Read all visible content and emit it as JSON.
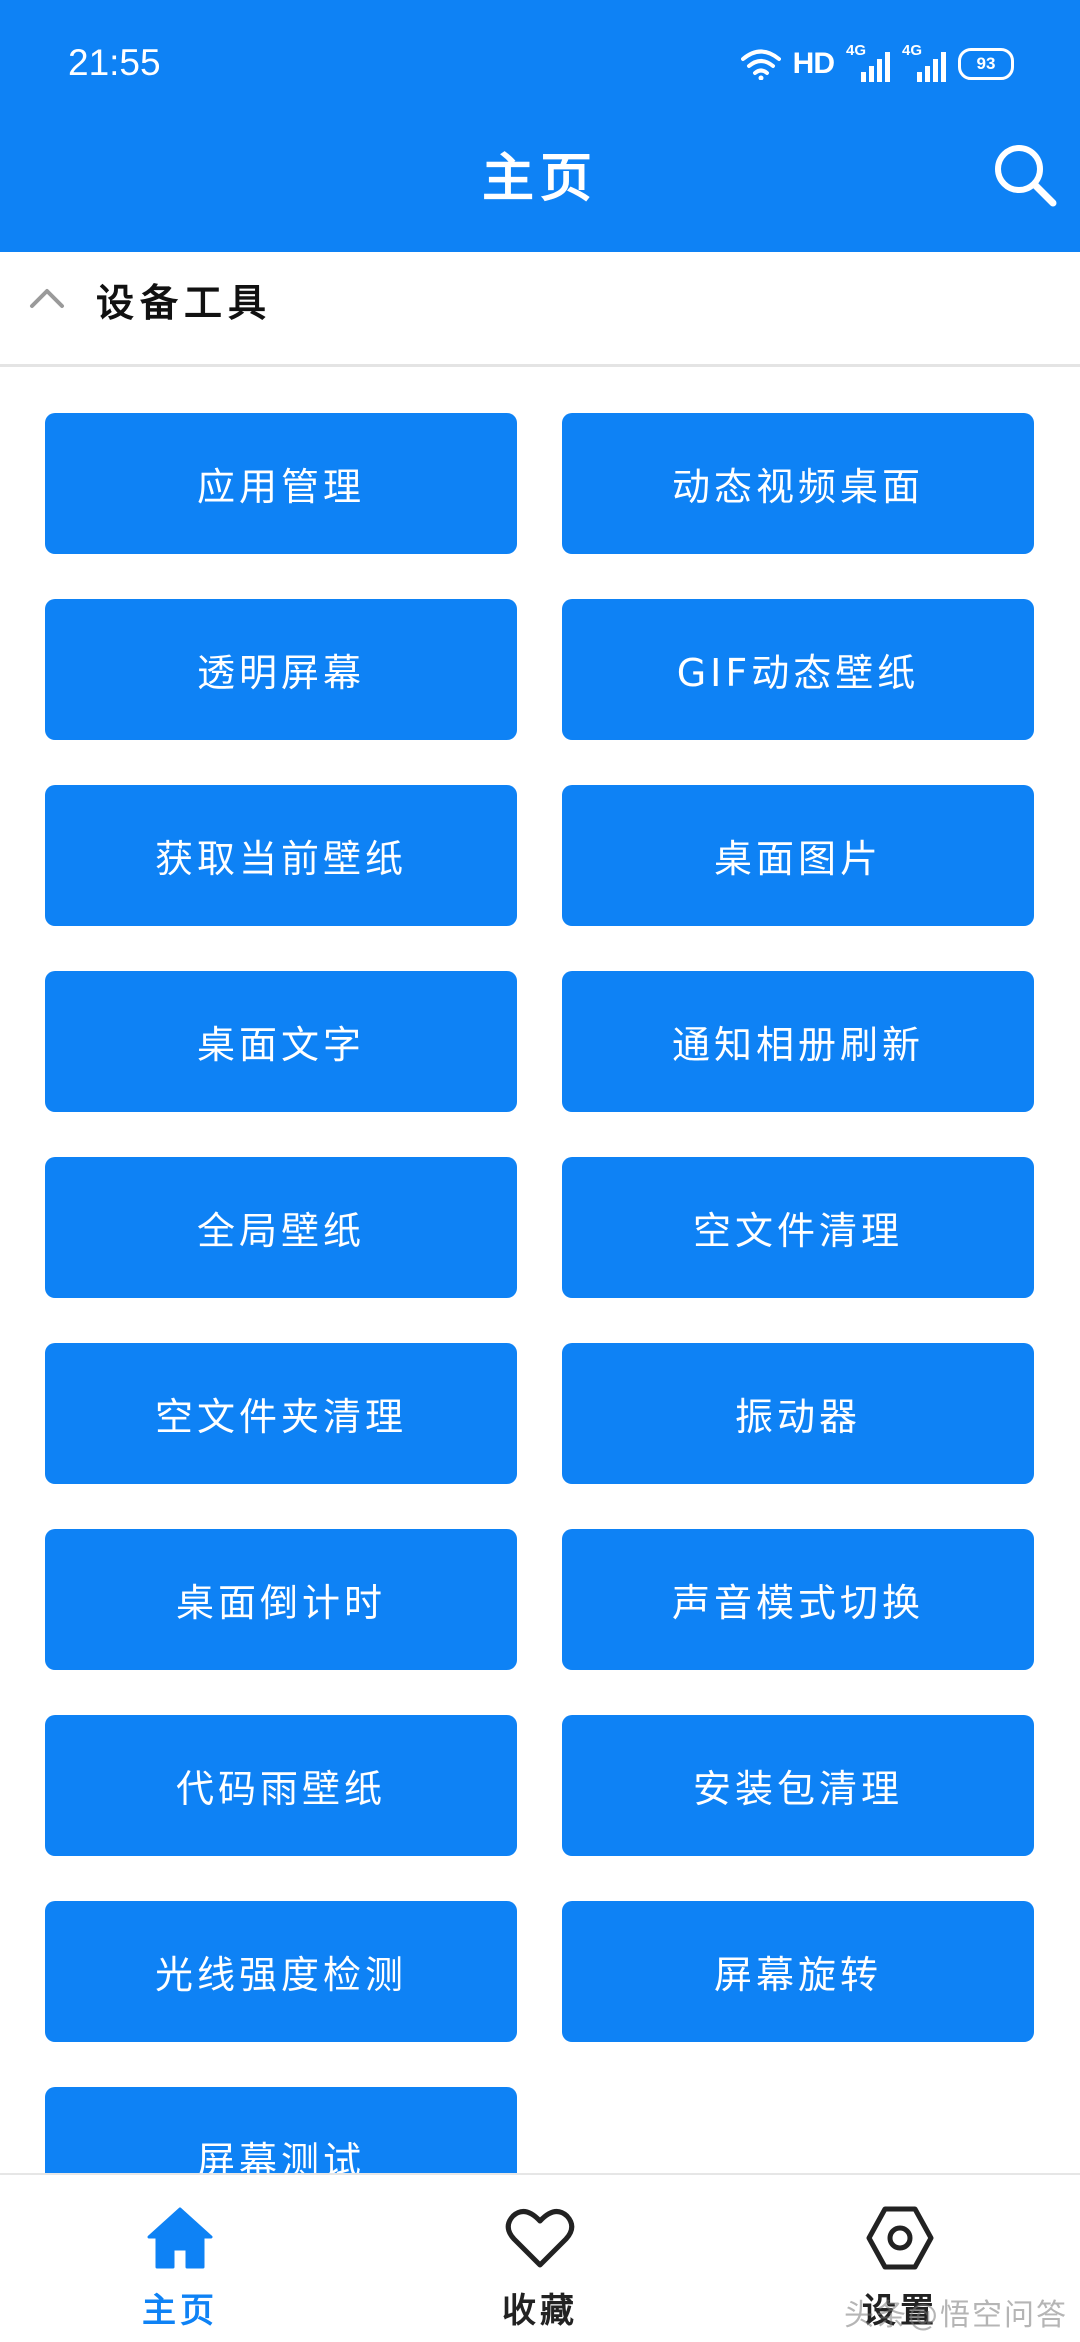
{
  "status_bar": {
    "time": "21:55",
    "network": "HD",
    "signal_1": "4G",
    "signal_2": "4G",
    "battery": "93"
  },
  "header": {
    "title": "主页",
    "search_icon": "search-icon"
  },
  "section": {
    "title": "设备工具",
    "toggle_icon": "chevron-up-icon"
  },
  "tools": [
    "应用管理",
    "动态视频桌面",
    "透明屏幕",
    "GIF动态壁纸",
    "获取当前壁纸",
    "桌面图片",
    "桌面文字",
    "通知相册刷新",
    "全局壁纸",
    "空文件清理",
    "空文件夹清理",
    "振动器",
    "桌面倒计时",
    "声音模式切换",
    "代码雨壁纸",
    "安装包清理",
    "光线强度检测",
    "屏幕旋转",
    "屏幕测试"
  ],
  "bottom_nav": {
    "home": {
      "label": "主页",
      "icon": "home-icon"
    },
    "favorites": {
      "label": "收藏",
      "icon": "heart-icon"
    },
    "settings": {
      "label": "设置",
      "icon": "settings-icon"
    }
  },
  "watermark": "头条@悟空问答",
  "colors": {
    "accent": "#0e82f5",
    "background": "#ffffff",
    "divider": "#e4e4e4"
  }
}
